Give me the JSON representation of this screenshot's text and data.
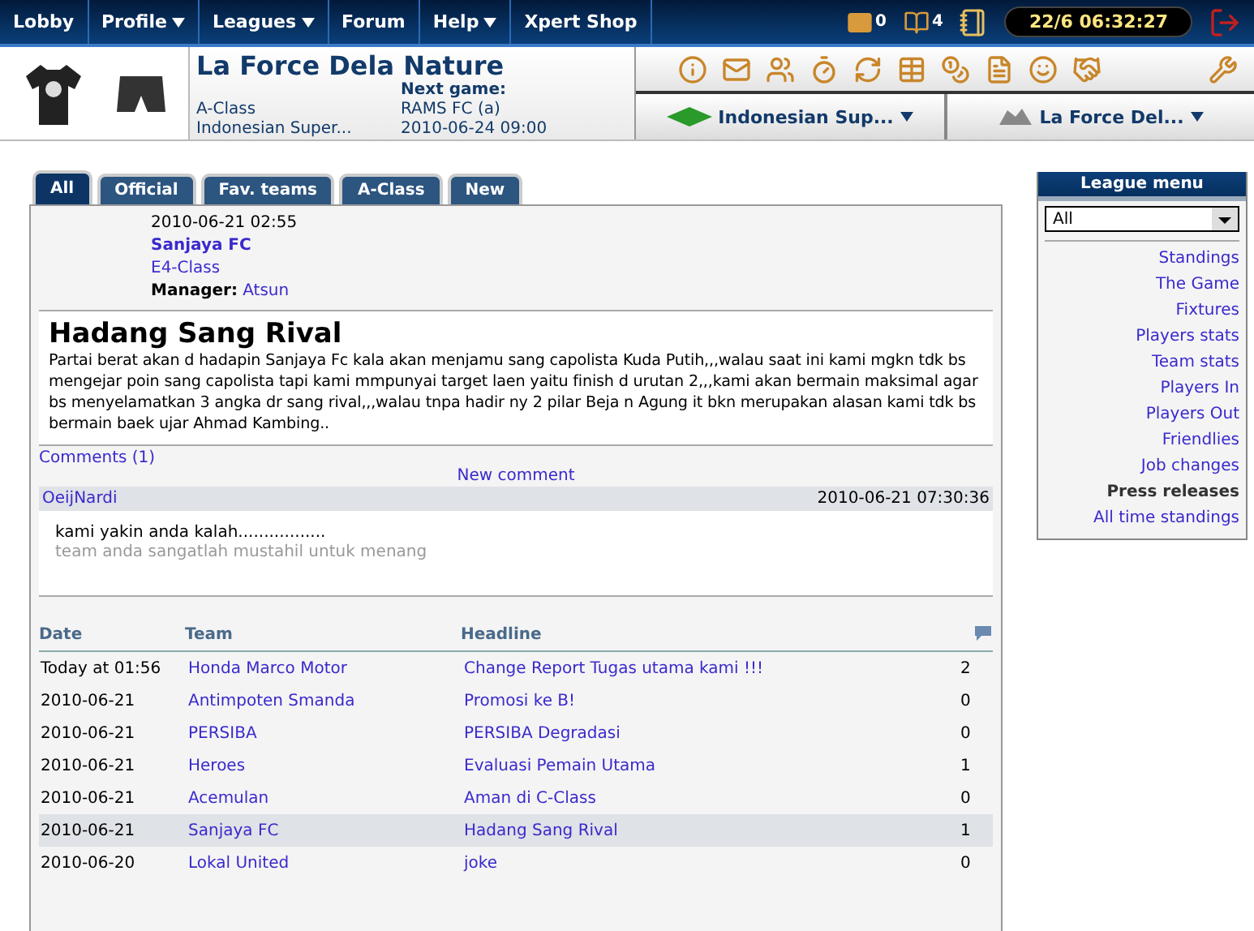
{
  "nav": {
    "items": [
      {
        "label": "Lobby",
        "dropdown": false
      },
      {
        "label": "Profile",
        "dropdown": true
      },
      {
        "label": "Leagues",
        "dropdown": true
      },
      {
        "label": "Forum",
        "dropdown": false
      },
      {
        "label": "Help",
        "dropdown": true
      },
      {
        "label": "Xpert Shop",
        "dropdown": false
      }
    ],
    "mail_count": "0",
    "guestbook_count": "4",
    "clock": "22/6 06:32:27"
  },
  "team": {
    "name": "La Force Dela Nature",
    "class": "A-Class",
    "league": "Indonesian Super...",
    "next_game_label": "Next game:",
    "next_opponent": "RAMS FC (a)",
    "next_date": "2010-06-24 09:00"
  },
  "selectors": {
    "league": "Indonesian Sup...",
    "team": "La Force Del..."
  },
  "tabs": [
    {
      "label": "All",
      "selected": true
    },
    {
      "label": "Official",
      "selected": false
    },
    {
      "label": "Fav. teams",
      "selected": false
    },
    {
      "label": "A-Class",
      "selected": false
    },
    {
      "label": "New",
      "selected": false
    }
  ],
  "release": {
    "date": "2010-06-21 02:55",
    "team": "Sanjaya FC",
    "class": "E4-Class",
    "manager_label": "Manager:",
    "manager": "Atsun",
    "title": "Hadang Sang Rival",
    "body": "Partai berat akan d hadapin Sanjaya Fc kala akan menjamu sang capolista Kuda Putih,,,walau saat ini kami mgkn tdk bs mengejar poin sang capolista tapi kami mmpunyai target laen yaitu finish d urutan 2,,,kami akan bermain maksimal agar bs menyelamatkan 3 angka dr sang rival,,,walau tnpa hadir ny 2 pilar Beja n Agung it bkn merupakan alasan kami tdk bs bermain baek ujar Ahmad Kambing.."
  },
  "comments": {
    "label": "Comments (1)",
    "new_comment": "New comment",
    "items": [
      {
        "author": "OeijNardi",
        "time": "2010-06-21 07:30:36",
        "text": "kami yakin anda kalah.................",
        "signature": "team anda sangatlah mustahil untuk menang"
      }
    ]
  },
  "table": {
    "columns": [
      "Date",
      "Team",
      "Headline"
    ],
    "rows": [
      {
        "date": "Today at 01:56",
        "team": "Honda Marco Motor",
        "headline": "Change Report Tugas utama kami !!!",
        "count": "2",
        "selected": false
      },
      {
        "date": "2010-06-21",
        "team": "Antimpoten Smanda",
        "headline": "Promosi ke B!",
        "count": "0",
        "selected": false
      },
      {
        "date": "2010-06-21",
        "team": "PERSIBA",
        "headline": "PERSIBA Degradasi",
        "count": "0",
        "selected": false
      },
      {
        "date": "2010-06-21",
        "team": "Heroes",
        "headline": "Evaluasi Pemain Utama",
        "count": "1",
        "selected": false
      },
      {
        "date": "2010-06-21",
        "team": "Acemulan",
        "headline": "Aman di C-Class",
        "count": "0",
        "selected": false
      },
      {
        "date": "2010-06-21",
        "team": "Sanjaya FC",
        "headline": "Hadang Sang Rival",
        "count": "1",
        "selected": true
      },
      {
        "date": "2010-06-20",
        "team": "Lokal United",
        "headline": "joke",
        "count": "0",
        "selected": false
      }
    ]
  },
  "league_menu": {
    "title": "League menu",
    "filter": "All",
    "items": [
      {
        "label": "Standings",
        "selected": false
      },
      {
        "label": "The Game",
        "selected": false
      },
      {
        "label": "Fixtures",
        "selected": false
      },
      {
        "label": "Players stats",
        "selected": false
      },
      {
        "label": "Team stats",
        "selected": false
      },
      {
        "label": "Players In",
        "selected": false
      },
      {
        "label": "Players Out",
        "selected": false
      },
      {
        "label": "Friendlies",
        "selected": false
      },
      {
        "label": "Job changes",
        "selected": false
      },
      {
        "label": "Press releases",
        "selected": true
      },
      {
        "label": "All time standings",
        "selected": false
      }
    ]
  }
}
